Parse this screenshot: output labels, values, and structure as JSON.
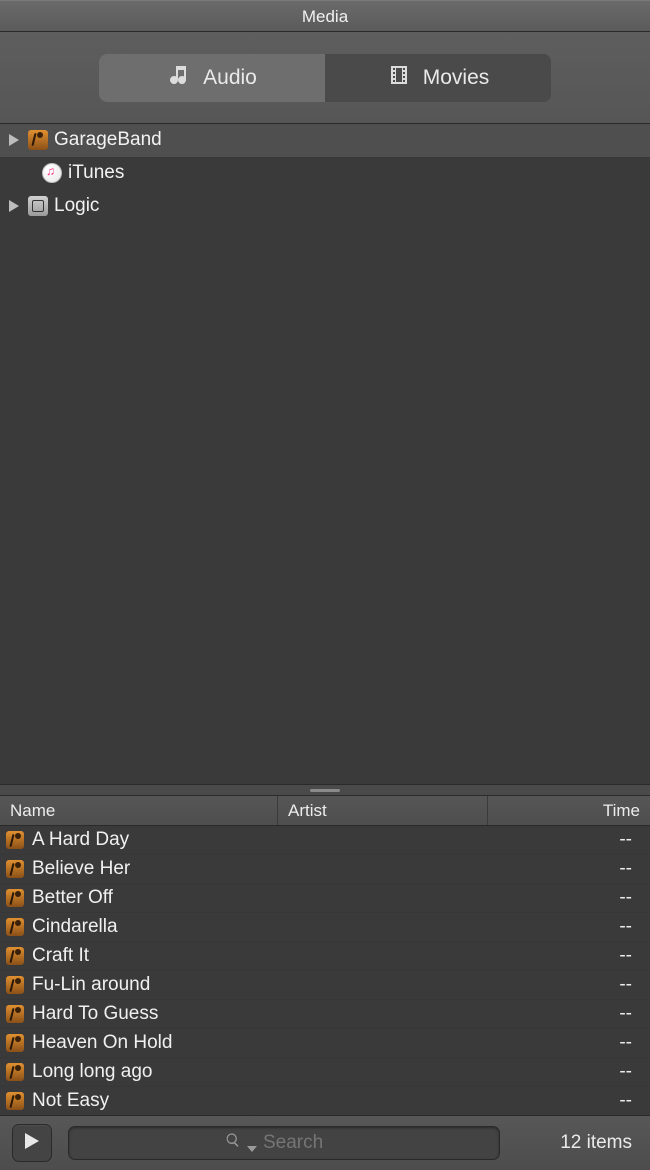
{
  "window": {
    "title": "Media"
  },
  "tabs": {
    "audio": {
      "label": "Audio",
      "icon": "music-note-icon",
      "active": true
    },
    "movies": {
      "label": "Movies",
      "icon": "film-icon",
      "active": false
    }
  },
  "sources": [
    {
      "label": "GarageBand",
      "icon": "garageband-icon",
      "expandable": true,
      "selected": true,
      "indent": 0
    },
    {
      "label": "iTunes",
      "icon": "itunes-icon",
      "expandable": false,
      "selected": false,
      "indent": 1
    },
    {
      "label": "Logic",
      "icon": "logic-icon",
      "expandable": true,
      "selected": false,
      "indent": 0
    }
  ],
  "columns": {
    "name": "Name",
    "artist": "Artist",
    "time": "Time"
  },
  "tracks": [
    {
      "name": "A Hard Day",
      "artist": "",
      "time": "--"
    },
    {
      "name": "Believe Her",
      "artist": "",
      "time": "--"
    },
    {
      "name": "Better Off",
      "artist": "",
      "time": "--"
    },
    {
      "name": "Cindarella",
      "artist": "",
      "time": "--"
    },
    {
      "name": "Craft It",
      "artist": "",
      "time": "--"
    },
    {
      "name": "Fu-Lin around",
      "artist": "",
      "time": "--"
    },
    {
      "name": "Hard To Guess",
      "artist": "",
      "time": "--"
    },
    {
      "name": "Heaven On Hold",
      "artist": "",
      "time": "--"
    },
    {
      "name": "Long long ago",
      "artist": "",
      "time": "--"
    },
    {
      "name": "Not Easy",
      "artist": "",
      "time": "--"
    }
  ],
  "footer": {
    "search_placeholder": "Search",
    "count_label": "12 items"
  }
}
